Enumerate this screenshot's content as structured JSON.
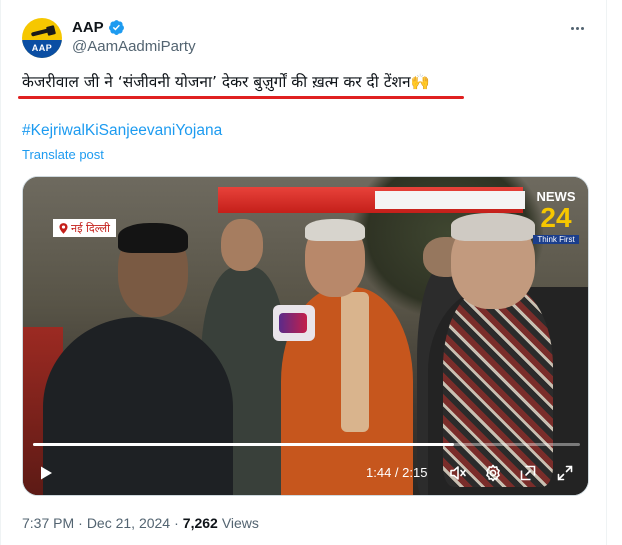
{
  "author": {
    "display_name": "AAP",
    "handle": "@AamAadmiParty",
    "avatar_text": "AAP",
    "verified": true
  },
  "tweet": {
    "text": "केजरीवाल जी ने ‘संजीवनी योजना’ देकर बुज़ुर्गों की ख़त्म कर दी टेंशन🙌",
    "hashtag": "#KejriwalKiSanjeevaniYojana",
    "translate_label": "Translate post"
  },
  "video": {
    "location_tag": "नई दिल्ली",
    "channel_name": "NEWS",
    "channel_number": "24",
    "channel_tagline": "Think First",
    "current_time": "1:44",
    "duration": "2:15",
    "time_display": "1:44 / 2:15",
    "progress_fraction": 0.77
  },
  "meta": {
    "time": "7:37 PM",
    "separator": "·",
    "date": "Dec 21, 2024",
    "views_count": "7,262",
    "views_label": "Views"
  },
  "colors": {
    "link": "#1d9bf0",
    "verified": "#1d9bf0",
    "underline": "#e02020",
    "muted": "#536471"
  },
  "icons": [
    "verified-badge-icon",
    "more-options-icon",
    "location-pin-icon",
    "play-icon",
    "volume-icon",
    "settings-gear-icon",
    "dock-icon",
    "fullscreen-icon"
  ]
}
